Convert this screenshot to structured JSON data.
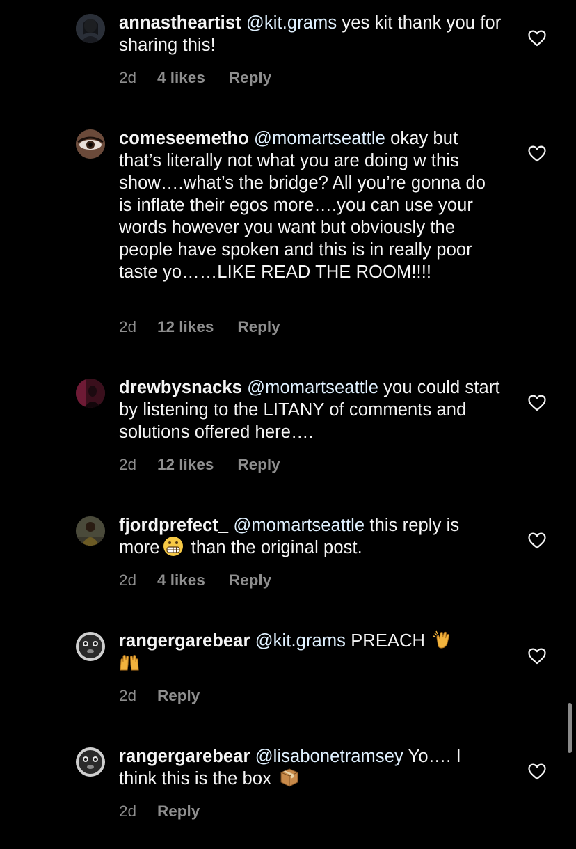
{
  "comments": [
    {
      "username": "annastheartist",
      "mention": "@kit.grams",
      "text": " yes kit thank you for sharing this!",
      "time": "2d",
      "likes": "4 likes",
      "reply": "Reply"
    },
    {
      "username": "comeseemetho",
      "mention": "@momartseattle",
      "text": " okay but that’s literally not what you are doing w this show….what’s the bridge? All you’re gonna do is inflate their egos more….you can use your words however you want but obviously the people have spoken and this is in really poor taste yo……LIKE READ THE ROOM!!!!",
      "time": "2d",
      "likes": "12 likes",
      "reply": "Reply"
    },
    {
      "username": "drewbysnacks",
      "mention": "@momartseattle",
      "text": " you could start by listening to the LITANY of comments and solutions offered here….",
      "time": "2d",
      "likes": "12 likes",
      "reply": "Reply"
    },
    {
      "username": "fjordprefect_",
      "mention": "@momartseattle",
      "text_before": " this reply is more",
      "text_after": " than the original post.",
      "emoji": "grimacing-face-emoji",
      "time": "2d",
      "likes": "4 likes",
      "reply": "Reply"
    },
    {
      "username": "rangergarebear",
      "mention": "@kit.grams",
      "text": " PREACH",
      "emoji": [
        "clapping-hands-emoji",
        "raising-hands-emoji"
      ],
      "time": "2d",
      "reply": "Reply"
    },
    {
      "username": "rangergarebear",
      "mention": "@lisabonetramsey",
      "text": " Yo…. I think this is the box",
      "emoji": "package-emoji",
      "time": "2d",
      "reply": "Reply"
    }
  ],
  "colors": {
    "background": "#000000",
    "text": "#f5f5f5",
    "mention": "#e0f1ff",
    "meta": "#8e8e8e"
  },
  "icons": {
    "like": "heart-outline-icon"
  }
}
